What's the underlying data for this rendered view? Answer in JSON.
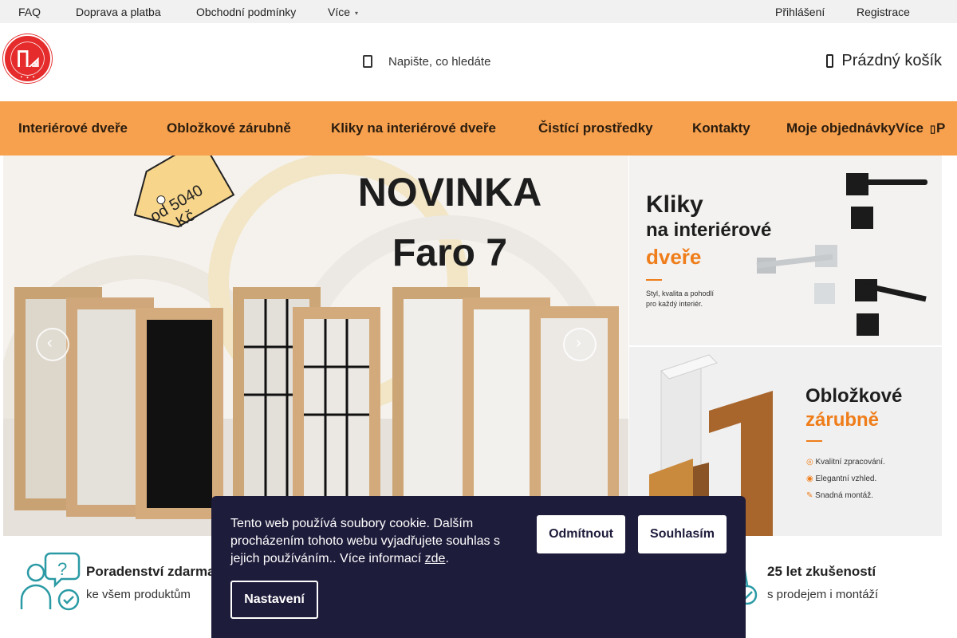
{
  "topbar": {
    "links": [
      "FAQ",
      "Doprava a platba",
      "Obchodní podmínky",
      "Více"
    ],
    "login": "Přihlášení",
    "register": "Registrace"
  },
  "header": {
    "search_placeholder": "Napište, co hledáte",
    "cart_label": "Prázdný košík",
    "logo_text": "dveře · podlahy · schody"
  },
  "nav": {
    "items": [
      "Interiérové dveře",
      "Obložkové zárubně",
      "Kliky na interiérové dveře",
      "Čistící prostředky",
      "Kontakty",
      "Moje objednávky",
      "Více",
      "P"
    ]
  },
  "hero": {
    "tag_text": "od 5040 Kč",
    "title": "NOVINKA",
    "subtitle": "Faro 7"
  },
  "banner1": {
    "title_line1": "Kliky",
    "title_line2": "na interiérové",
    "title_accent": "dveře",
    "desc1": "Styl, kvalita a pohodlí",
    "desc2": "pro každý interiér."
  },
  "banner2": {
    "title": "Obložkové",
    "title_accent": "zárubně",
    "points": [
      "Kvalitní zpracování.",
      "Elegantní vzhled.",
      "Snadná montáž."
    ]
  },
  "features": [
    {
      "title": "Poradenství zdarma",
      "sub": "ke všem produktům"
    },
    {
      "title": "25 let zkušeností",
      "sub": "s prodejem i montáží"
    }
  ],
  "cookie": {
    "text": "Tento web používá soubory cookie. Dalším procházením tohoto webu vyjadřujete souhlas s jejich používáním.. Více informací ",
    "link": "zde",
    "after": ".",
    "reject": "Odmítnout",
    "accept": "Souhlasím",
    "settings": "Nastavení"
  },
  "colors": {
    "accent": "#f7a14e",
    "cookie_bg": "#1e1c3b",
    "logo": "#e52b2b",
    "icon": "#2a9aa5"
  }
}
